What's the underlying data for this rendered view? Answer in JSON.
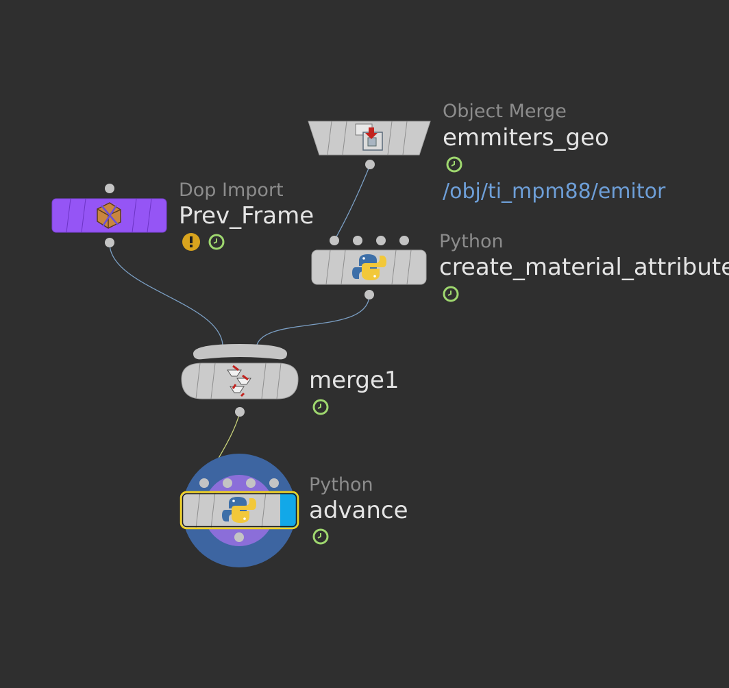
{
  "network": {
    "nodes": {
      "emmiters_geo": {
        "type": "Object Merge",
        "name": "emmiters_geo",
        "path": "/obj/ti_mpm88/emitor",
        "icon": "object-merge-icon",
        "badges": [
          "time-dependent-icon"
        ]
      },
      "prev_frame": {
        "type": "Dop Import",
        "name": "Prev_Frame",
        "icon": "dop-import-icon",
        "color": "#9555f5",
        "badges": [
          "warning-icon",
          "time-dependent-icon"
        ]
      },
      "create_material_attribute": {
        "type": "Python",
        "name": "create_material_attribute",
        "icon": "python-icon",
        "badges": [
          "time-dependent-icon"
        ]
      },
      "merge1": {
        "name": "merge1",
        "icon": "merge-icon",
        "badges": [
          "time-dependent-icon"
        ]
      },
      "advance": {
        "type": "Python",
        "name": "advance",
        "icon": "python-icon",
        "selected": true,
        "display_flag": true,
        "badges": [
          "time-dependent-icon"
        ]
      }
    },
    "colors": {
      "background": "#2f2f2f",
      "wire": "#7b9fc4",
      "selected_wire": "#c8d27a",
      "display_flag": "#12a8e8",
      "selection_outline": "#f2d21e",
      "warning": "#d9a41e",
      "time_badge": "#9fd86f"
    }
  }
}
